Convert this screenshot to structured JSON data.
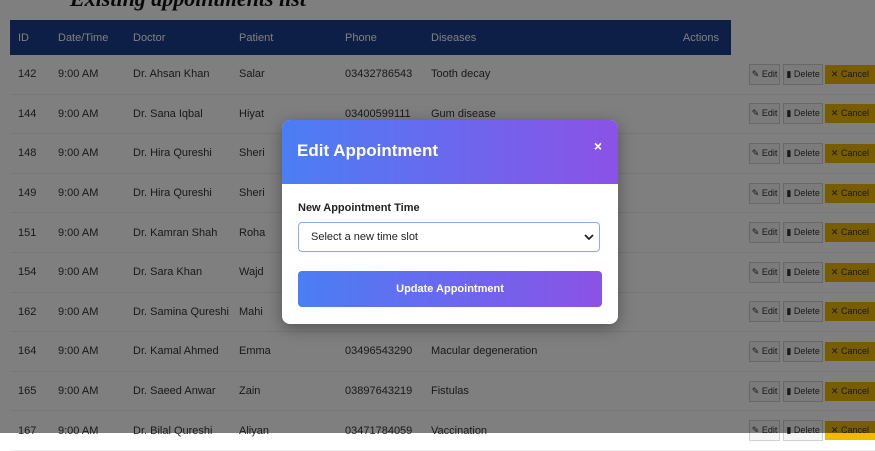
{
  "page": {
    "heading": "Existing appointments list"
  },
  "table": {
    "columns": [
      "ID",
      "Date/Time",
      "Doctor",
      "Patient",
      "Phone",
      "Diseases",
      "Actions"
    ],
    "rows": [
      [
        "142",
        "9:00 AM",
        "Dr. Ahsan Khan",
        "Salar",
        "03432786543",
        "Tooth decay"
      ],
      [
        "144",
        "9:00 AM",
        "Dr. Sana Iqbal",
        "Hiyat",
        "03400599111",
        "Gum disease"
      ],
      [
        "148",
        "9:00 AM",
        "Dr. Hira Qureshi",
        "Sheri",
        "",
        ""
      ],
      [
        "149",
        "9:00 AM",
        "Dr. Hira Qureshi",
        "Sheri",
        "",
        ""
      ],
      [
        "151",
        "9:00 AM",
        "Dr. Kamran Shah",
        "Roha",
        "",
        ""
      ],
      [
        "154",
        "9:00 AM",
        "Dr. Sara Khan",
        "Wajd",
        "",
        ""
      ],
      [
        "162",
        "9:00 AM",
        "Dr. Samina Qureshi",
        "Mahi",
        "",
        ""
      ],
      [
        "164",
        "9:00 AM",
        "Dr. Kamal Ahmed",
        "Emma",
        "03496543290",
        "Macular degeneration"
      ],
      [
        "165",
        "9:00 AM",
        "Dr. Saeed Anwar",
        "Zain",
        "03897643219",
        "Fistulas"
      ],
      [
        "167",
        "9:00 AM",
        "Dr. Bilal Qureshi",
        "Aliyan",
        "03471784059",
        "Vaccination"
      ]
    ],
    "actions": {
      "edit": "Edit",
      "delete": "Delete",
      "cancel": "Cancel"
    }
  },
  "modal": {
    "title": "Edit Appointment",
    "close": "×",
    "field_label": "New Appointment Time",
    "select_value": "Select a new time slot",
    "submit": "Update Appointment"
  },
  "colors": {
    "table_header": "#1a3e8c",
    "gradient_start": "#4a7ef5",
    "gradient_end": "#8b52e6",
    "cancel_button": "#f0b800"
  },
  "icons": {
    "edit": "pencil-square-icon",
    "delete": "trash-icon",
    "cancel": "x-icon",
    "select": "chevron-down-icon"
  }
}
